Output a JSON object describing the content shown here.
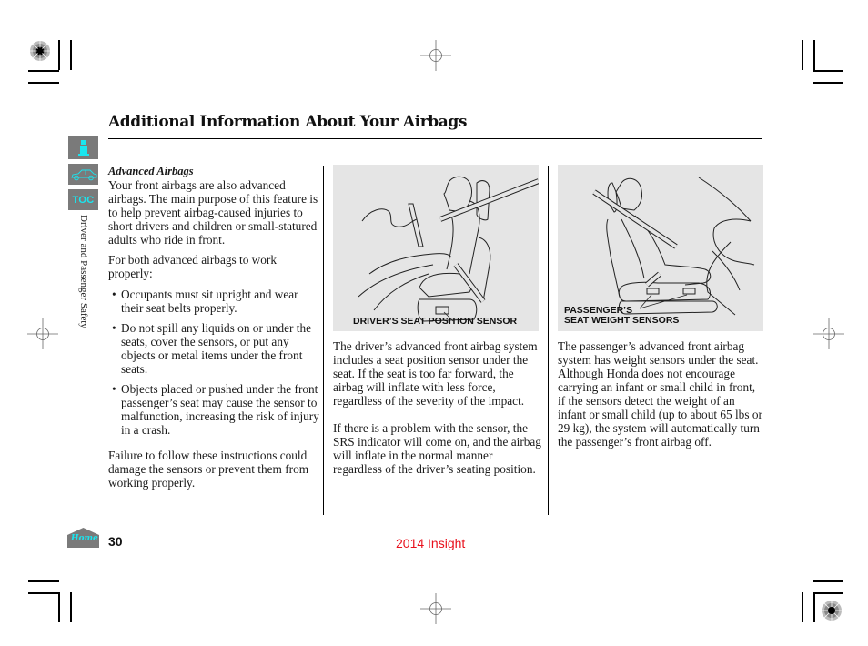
{
  "header": {
    "title": "Additional Information About Your Airbags"
  },
  "nav": {
    "info_icon": "info-icon",
    "vehicle_icon": "car-icon",
    "toc_label": "TOC",
    "home_label": "Home",
    "section_label": "Driver and Passenger Safety"
  },
  "column1": {
    "subheading": "Advanced Airbags",
    "intro": "Your front airbags are also advanced airbags. The main purpose of this feature is to help prevent airbag-caused injuries to short drivers and children or small-statured adults who ride in front.",
    "lead": "For both advanced airbags to work properly:",
    "bullets": [
      "Occupants must sit upright and wear their seat belts properly.",
      "Do not spill any liquids on or under the seats, cover the sensors, or put any objects or metal items under the front seats.",
      "Objects placed or pushed under the front passenger’s seat may cause the sensor to malfunction, increasing the risk of injury in a crash."
    ],
    "warning": "Failure to follow these instructions could damage the sensors or prevent them from working properly."
  },
  "column2": {
    "figure_caption": "DRIVER’S SEAT POSITION SENSOR",
    "para1": "The driver’s advanced front airbag system includes a seat position sensor under the seat. If the seat is too far forward, the airbag will inflate with less force, regardless of the severity of the impact.",
    "para2": "If there is a problem with the sensor, the SRS indicator will come on, and the airbag will inflate in the normal manner regardless of the driver’s seating position."
  },
  "column3": {
    "figure_caption_line1": "PASSENGER’S",
    "figure_caption_line2": "SEAT WEIGHT SENSORS",
    "para1": "The passenger’s advanced front airbag system has weight sensors under the seat. Although Honda does not encourage carrying an infant or small child in front, if the sensors detect the weight of an infant or small child (up to about 65 lbs or 29 kg), the system will automatically turn the passenger’s front airbag off."
  },
  "footer": {
    "page_number": "30",
    "model": "2014 Insight"
  },
  "colors": {
    "nav_button": "#7a7a7a",
    "nav_glyph": "#19e6f0",
    "model_text": "#e8101c",
    "figure_bg": "#e5e5e5"
  }
}
